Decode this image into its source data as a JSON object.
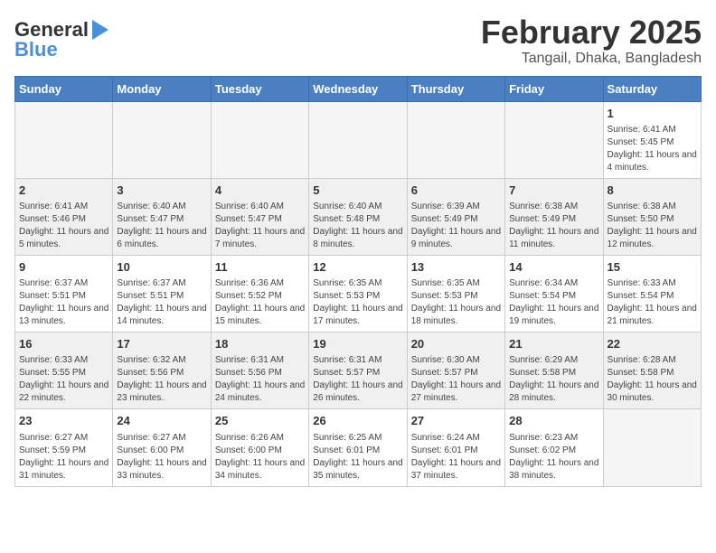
{
  "logo": {
    "text1": "General",
    "text2": "Blue"
  },
  "title": "February 2025",
  "subtitle": "Tangail, Dhaka, Bangladesh",
  "days_of_week": [
    "Sunday",
    "Monday",
    "Tuesday",
    "Wednesday",
    "Thursday",
    "Friday",
    "Saturday"
  ],
  "weeks": [
    [
      {
        "num": "",
        "info": ""
      },
      {
        "num": "",
        "info": ""
      },
      {
        "num": "",
        "info": ""
      },
      {
        "num": "",
        "info": ""
      },
      {
        "num": "",
        "info": ""
      },
      {
        "num": "",
        "info": ""
      },
      {
        "num": "1",
        "info": "Sunrise: 6:41 AM\nSunset: 5:45 PM\nDaylight: 11 hours and 4 minutes."
      }
    ],
    [
      {
        "num": "2",
        "info": "Sunrise: 6:41 AM\nSunset: 5:46 PM\nDaylight: 11 hours and 5 minutes."
      },
      {
        "num": "3",
        "info": "Sunrise: 6:40 AM\nSunset: 5:47 PM\nDaylight: 11 hours and 6 minutes."
      },
      {
        "num": "4",
        "info": "Sunrise: 6:40 AM\nSunset: 5:47 PM\nDaylight: 11 hours and 7 minutes."
      },
      {
        "num": "5",
        "info": "Sunrise: 6:40 AM\nSunset: 5:48 PM\nDaylight: 11 hours and 8 minutes."
      },
      {
        "num": "6",
        "info": "Sunrise: 6:39 AM\nSunset: 5:49 PM\nDaylight: 11 hours and 9 minutes."
      },
      {
        "num": "7",
        "info": "Sunrise: 6:38 AM\nSunset: 5:49 PM\nDaylight: 11 hours and 11 minutes."
      },
      {
        "num": "8",
        "info": "Sunrise: 6:38 AM\nSunset: 5:50 PM\nDaylight: 11 hours and 12 minutes."
      }
    ],
    [
      {
        "num": "9",
        "info": "Sunrise: 6:37 AM\nSunset: 5:51 PM\nDaylight: 11 hours and 13 minutes."
      },
      {
        "num": "10",
        "info": "Sunrise: 6:37 AM\nSunset: 5:51 PM\nDaylight: 11 hours and 14 minutes."
      },
      {
        "num": "11",
        "info": "Sunrise: 6:36 AM\nSunset: 5:52 PM\nDaylight: 11 hours and 15 minutes."
      },
      {
        "num": "12",
        "info": "Sunrise: 6:35 AM\nSunset: 5:53 PM\nDaylight: 11 hours and 17 minutes."
      },
      {
        "num": "13",
        "info": "Sunrise: 6:35 AM\nSunset: 5:53 PM\nDaylight: 11 hours and 18 minutes."
      },
      {
        "num": "14",
        "info": "Sunrise: 6:34 AM\nSunset: 5:54 PM\nDaylight: 11 hours and 19 minutes."
      },
      {
        "num": "15",
        "info": "Sunrise: 6:33 AM\nSunset: 5:54 PM\nDaylight: 11 hours and 21 minutes."
      }
    ],
    [
      {
        "num": "16",
        "info": "Sunrise: 6:33 AM\nSunset: 5:55 PM\nDaylight: 11 hours and 22 minutes."
      },
      {
        "num": "17",
        "info": "Sunrise: 6:32 AM\nSunset: 5:56 PM\nDaylight: 11 hours and 23 minutes."
      },
      {
        "num": "18",
        "info": "Sunrise: 6:31 AM\nSunset: 5:56 PM\nDaylight: 11 hours and 24 minutes."
      },
      {
        "num": "19",
        "info": "Sunrise: 6:31 AM\nSunset: 5:57 PM\nDaylight: 11 hours and 26 minutes."
      },
      {
        "num": "20",
        "info": "Sunrise: 6:30 AM\nSunset: 5:57 PM\nDaylight: 11 hours and 27 minutes."
      },
      {
        "num": "21",
        "info": "Sunrise: 6:29 AM\nSunset: 5:58 PM\nDaylight: 11 hours and 28 minutes."
      },
      {
        "num": "22",
        "info": "Sunrise: 6:28 AM\nSunset: 5:58 PM\nDaylight: 11 hours and 30 minutes."
      }
    ],
    [
      {
        "num": "23",
        "info": "Sunrise: 6:27 AM\nSunset: 5:59 PM\nDaylight: 11 hours and 31 minutes."
      },
      {
        "num": "24",
        "info": "Sunrise: 6:27 AM\nSunset: 6:00 PM\nDaylight: 11 hours and 33 minutes."
      },
      {
        "num": "25",
        "info": "Sunrise: 6:26 AM\nSunset: 6:00 PM\nDaylight: 11 hours and 34 minutes."
      },
      {
        "num": "26",
        "info": "Sunrise: 6:25 AM\nSunset: 6:01 PM\nDaylight: 11 hours and 35 minutes."
      },
      {
        "num": "27",
        "info": "Sunrise: 6:24 AM\nSunset: 6:01 PM\nDaylight: 11 hours and 37 minutes."
      },
      {
        "num": "28",
        "info": "Sunrise: 6:23 AM\nSunset: 6:02 PM\nDaylight: 11 hours and 38 minutes."
      },
      {
        "num": "",
        "info": ""
      }
    ]
  ]
}
